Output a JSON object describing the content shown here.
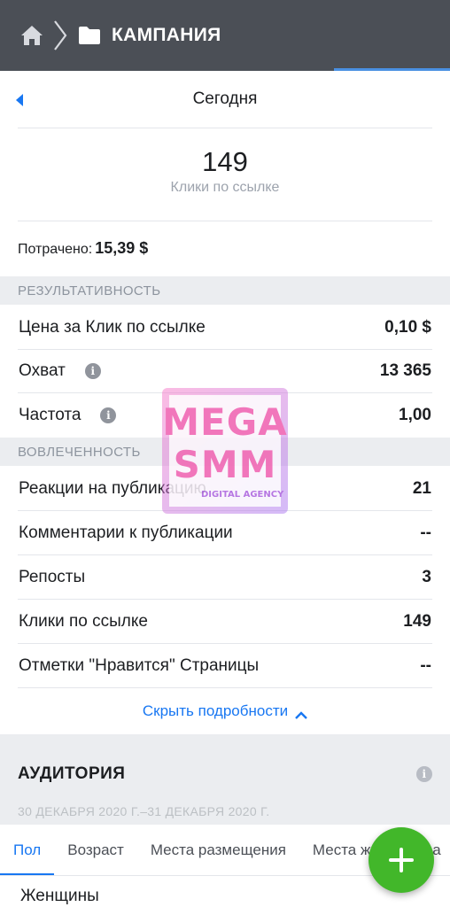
{
  "header": {
    "title": "КАМПАНИЯ",
    "icons": [
      "home-icon",
      "chevron-right-icon",
      "folder-icon"
    ],
    "bg_color": "#4b4f56"
  },
  "date_selector": {
    "label": "Сегодня"
  },
  "summary": {
    "value": "149",
    "caption": "Клики по ссылке"
  },
  "spent": {
    "label": "Потрачено:",
    "amount": "15,39 $"
  },
  "sections": {
    "performance": "РЕЗУЛЬТАТИВНОСТЬ",
    "engagement": "ВОВЛЕЧЕННОСТЬ"
  },
  "performance_rows": [
    {
      "label": "Цена за Клик по ссылке",
      "value": "0,10 $"
    },
    {
      "label": "Охват",
      "value": "13 365"
    },
    {
      "label": "Частота",
      "value": "1,00"
    }
  ],
  "engagement_rows": [
    {
      "label": "Реакции на публикацию",
      "value": "21"
    },
    {
      "label": "Комментарии к публикации",
      "value": "--"
    },
    {
      "label": "Репосты",
      "value": "3"
    },
    {
      "label": "Клики по ссылке",
      "value": "149"
    },
    {
      "label": "Отметки \"Нравится\" Страницы",
      "value": "--"
    }
  ],
  "hide_details": "Скрыть подробности",
  "audience": {
    "title": "АУДИТОРИЯ",
    "date_range": "30 ДЕКАБРЯ 2020 Г.–31 ДЕКАБРЯ 2020 Г.",
    "tabs": [
      "Пол",
      "Возраст",
      "Места размещения",
      "Места жительства"
    ],
    "active_tab": "Пол",
    "first_item": "Женщины"
  },
  "watermark": {
    "line1": "MEGA",
    "line2": "SMM",
    "tagline": "DIGITAL AGENCY"
  },
  "colors": {
    "accent": "#1877f2",
    "fab": "#42b72a",
    "section_bg": "#ebedf0"
  }
}
